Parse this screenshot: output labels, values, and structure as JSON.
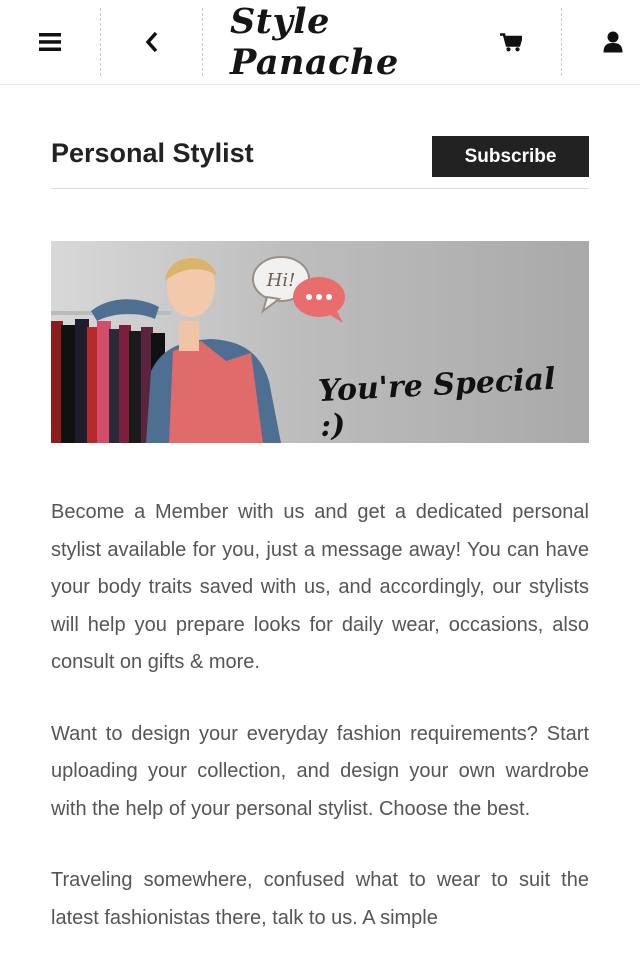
{
  "header": {
    "logo": "Style Panache",
    "icons": [
      "menu-icon",
      "back-icon",
      "cart-icon",
      "user-icon"
    ]
  },
  "page": {
    "title": "Personal Stylist",
    "subscribe_label": "Subscribe"
  },
  "banner": {
    "bubble_text": "Hi!",
    "caption": "You're Special :)"
  },
  "content": {
    "paragraphs": [
      "Become a Member with us and get a dedicated personal stylist available for you, just a message away! You can have your body traits saved with us, and accordingly, our stylists will help you prepare looks for daily wear, occasions, also consult on gifts & more.",
      "Want to design your everyday fashion requirements? Start uploading your collection, and design your own wardrobe with the help of your personal stylist. Choose the best.",
      "Traveling somewhere, confused what to wear to suit the latest fashionistas there, talk to us. A simple"
    ]
  },
  "colors": {
    "header_bg": "#ffffff",
    "button_bg": "#222222",
    "body_text": "#555555"
  }
}
